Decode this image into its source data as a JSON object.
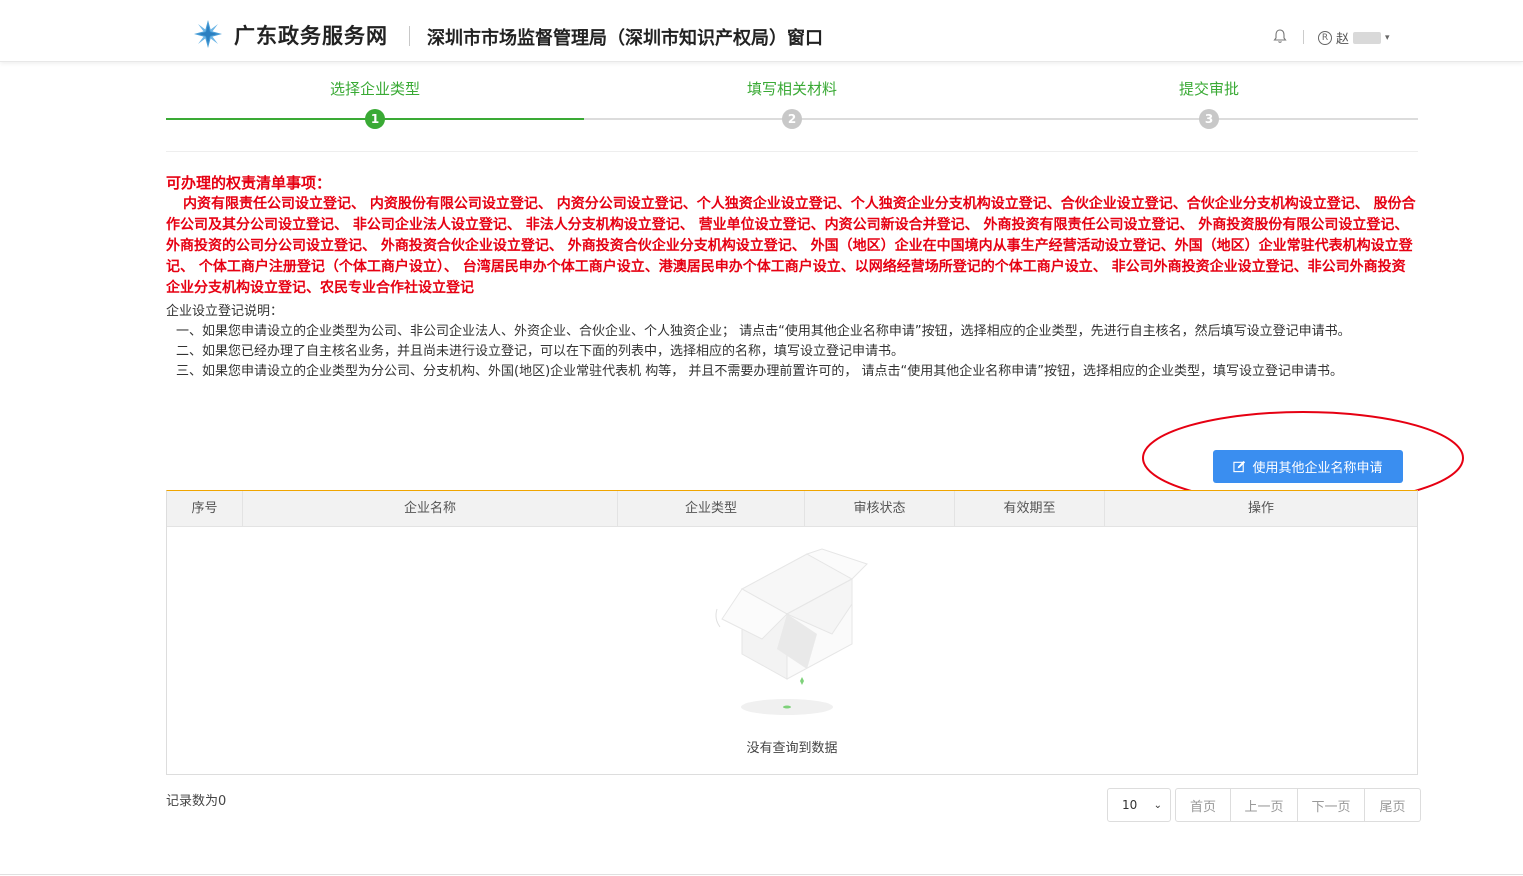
{
  "header": {
    "brand": "广东政务服务网",
    "window_title": "深圳市市场监督管理局（深圳市知识产权局）窗口",
    "user_name": "赵"
  },
  "steps": [
    {
      "label": "选择企业类型",
      "number": "1",
      "state": "active"
    },
    {
      "label": "填写相关材料",
      "number": "2",
      "state": "pending"
    },
    {
      "label": "提交审批",
      "number": "3",
      "state": "pending"
    }
  ],
  "colors": {
    "active": "#3aaa35",
    "pending": "#c8c8c8",
    "notice_red": "#e60012",
    "primary_button": "#3a8ef0",
    "table_top_border": "#f0a500"
  },
  "notice": {
    "title": "可办理的权责清单事项：",
    "items_text": "内资有限责任公司设立登记、 内资股份有限公司设立登记、 内资分公司设立登记、个人独资企业设立登记、个人独资企业分支机构设立登记、合伙企业设立登记、合伙企业分支机构设立登记、 股份合作公司及其分公司设立登记、 非公司企业法人设立登记、 非法人分支机构设立登记、 营业单位设立登记、内资公司新设合并登记、 外商投资有限责任公司设立登记、 外商投资股份有限公司设立登记、 外商投资的公司分公司设立登记、 外商投资合伙企业设立登记、 外商投资合伙企业分支机构设立登记、 外国（地区）企业在中国境内从事生产经营活动设立登记、外国（地区）企业常驻代表机构设立登记、 个体工商户注册登记（个体工商户设立）、 台湾居民申办个体工商户设立、港澳居民申办个体工商户设立、以网络经营场所登记的个体工商户设立、 非公司外商投资企业设立登记、非公司外商投资企业分支机构设立登记、农民专业合作社设立登记",
    "subtitle": "企业设立登记说明：",
    "paragraphs": [
      "一、如果您申请设立的企业类型为公司、非公司企业法人、外资企业、合伙企业、个人独资企业； 请点击“使用其他企业名称申请”按钮，选择相应的企业类型，先进行自主核名，然后填写设立登记申请书。",
      "二、如果您已经办理了自主核名业务，并且尚未进行设立登记，可以在下面的列表中，选择相应的名称，填写设立登记申请书。",
      "三、如果您申请设立的企业类型为分公司、分支机构、外国(地区)企业常驻代表机 构等， 并且不需要办理前置许可的， 请点击“使用其他企业名称申请”按钮，选择相应的企业类型，填写设立登记申请书。"
    ]
  },
  "action_button": {
    "label": "使用其他企业名称申请",
    "icon": "edit-icon"
  },
  "table": {
    "columns": [
      "序号",
      "企业名称",
      "企业类型",
      "审核状态",
      "有效期至",
      "操作"
    ],
    "rows": [],
    "empty_text": "没有查询到数据"
  },
  "footer": {
    "record_count": "记录数为0",
    "page_size": "10",
    "buttons": {
      "first": "首页",
      "prev": "上一页",
      "next": "下一页",
      "last": "尾页"
    }
  }
}
